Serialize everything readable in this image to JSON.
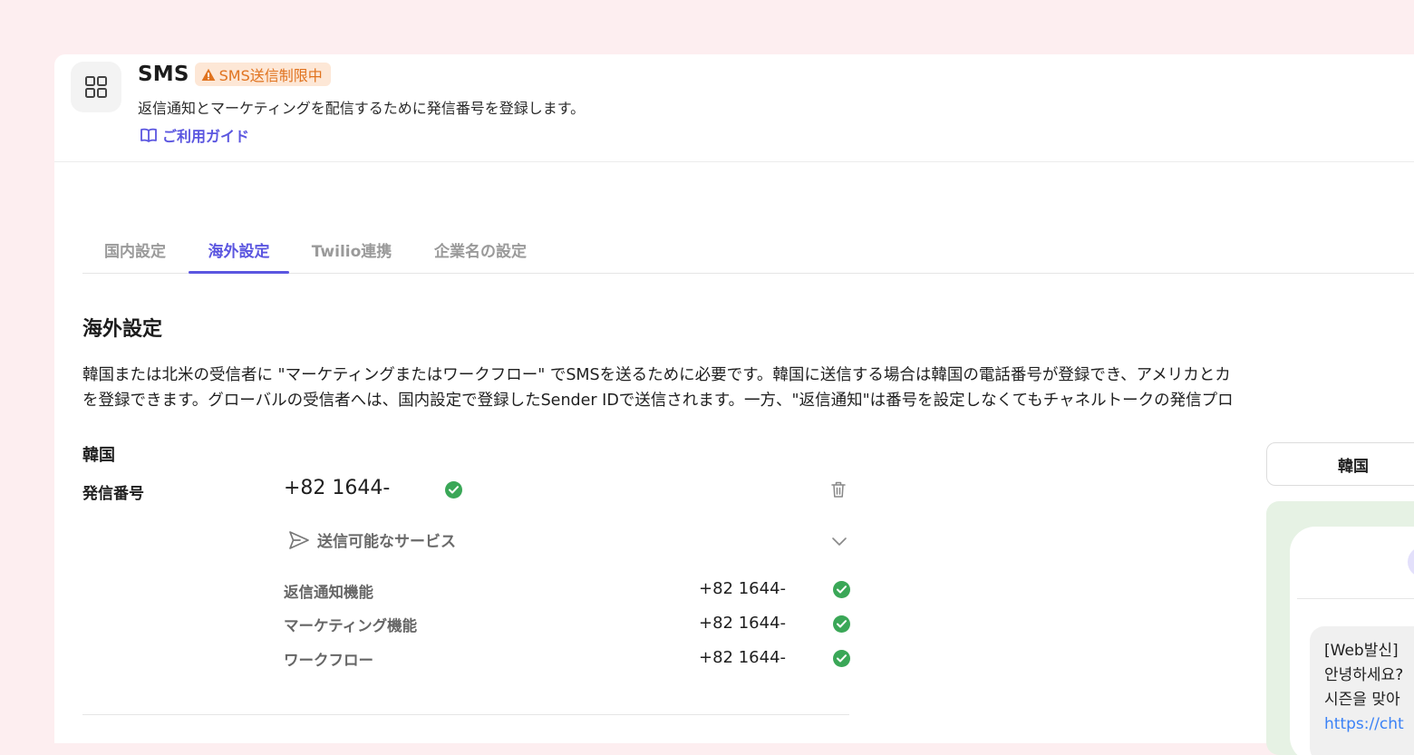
{
  "header": {
    "title": "SMS",
    "badge": "SMS送信制限中",
    "subtitle": "返信通知とマーケティングを配信するために発信番号を登録します。",
    "guide_link": "ご利用ガイド"
  },
  "tabs": [
    {
      "label": "国内設定",
      "active": false
    },
    {
      "label": "海外設定",
      "active": true
    },
    {
      "label": "Twilio連携",
      "active": false
    },
    {
      "label": "企業名の設定",
      "active": false
    }
  ],
  "section": {
    "title": "海外設定",
    "description": [
      "韓国または北米の受信者に \"マーケティングまたはワークフロー\" でSMSを送るために必要です。韓国に送信する場合は韓国の電話番号が登録でき、アメリカとカ",
      "を登録できます。グローバルの受信者へは、国内設定で登録したSender IDで送信されます。一方、\"返信通知\"は番号を設定しなくてもチャネルトークの発信プロ"
    ]
  },
  "korea": {
    "country_label": "韓国",
    "sender_label": "発信番号",
    "sender_number": "+82 1644-",
    "services_label": "送信可能なサービス",
    "services": [
      {
        "name": "返信通知機能",
        "number": "+82 1644-"
      },
      {
        "name": "マーケティング機能",
        "number": "+82 1644-"
      },
      {
        "name": "ワークフロー",
        "number": "+82 1644-"
      }
    ]
  },
  "preview": {
    "country_select": "韓国",
    "message_lines": [
      "[Web발신]",
      "안녕하세요?",
      "시즌을 맞아",
      "https://cht"
    ]
  },
  "colors": {
    "accent": "#5b56e0",
    "warning": "#e0731f",
    "warning_bg": "#fde7d6",
    "success": "#3aa757",
    "page_bg": "#fdeef0",
    "preview_bg": "#e6f2e4"
  }
}
